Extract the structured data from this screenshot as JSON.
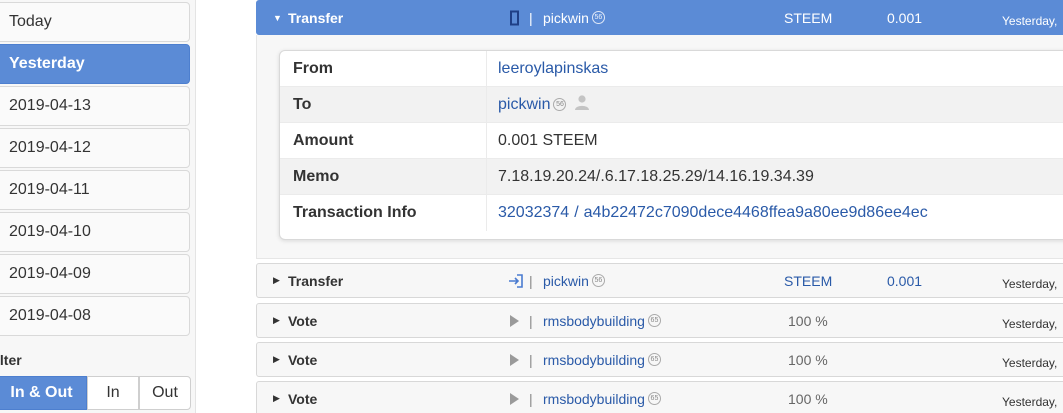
{
  "sidebar": {
    "days": [
      "Today",
      "Yesterday",
      "2019-04-13",
      "2019-04-12",
      "2019-04-11",
      "2019-04-10",
      "2019-04-09",
      "2019-04-08"
    ],
    "active_day": "Yesterday",
    "filter_label": "ilter",
    "filter_options": [
      "In & Out",
      "In",
      "Out"
    ],
    "active_filter": "In & Out"
  },
  "list": {
    "expanded": {
      "type": "Transfer",
      "account": "pickwin",
      "reputation": "56",
      "currency": "STEEM",
      "amount": "0.001",
      "time": "Yesterday,",
      "details": {
        "from_label": "From",
        "from": "leeroylapinskas",
        "to_label": "To",
        "to": "pickwin",
        "to_reputation": "56",
        "amount_label": "Amount",
        "amount": "0.001 STEEM",
        "memo_label": "Memo",
        "memo": "7.18.19.20.24/.6.17.18.25.29/14.16.19.34.39",
        "tx_label": "Transaction Info",
        "tx_block": "32032374",
        "tx_sep": "/",
        "tx_id": "a4b22472c7090dece4468ffea9a80ee9d86ee4ec"
      }
    },
    "rows": [
      {
        "type": "Transfer",
        "account": "pickwin",
        "reputation": "56",
        "currency": "STEEM",
        "amount": "0.001",
        "time": "Yesterday, "
      },
      {
        "type": "Vote",
        "account": "rmsbodybuilding",
        "reputation": "65",
        "percent": "100 %",
        "time": "Yesterday, "
      },
      {
        "type": "Vote",
        "account": "rmsbodybuilding",
        "reputation": "65",
        "percent": "100 %",
        "time": "Yesterday, "
      },
      {
        "type": "Vote",
        "account": "rmsbodybuilding",
        "reputation": "65",
        "percent": "100 %",
        "time": "Yesterday, "
      }
    ],
    "separator": "|"
  },
  "colors": {
    "accent": "#5b8bd6",
    "link": "#2a5aa8"
  }
}
